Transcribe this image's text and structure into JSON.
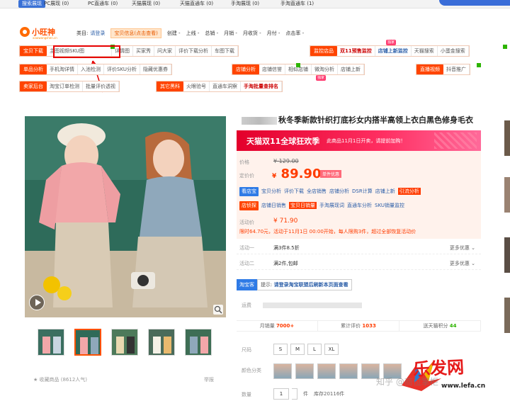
{
  "top_strip": {
    "tag": "搜索展现",
    "items": [
      "PC展现 (0)",
      "PC直通车 (0)",
      "天猫展现 (0)",
      "天猫直通车 (0)",
      "手淘展现 (0)",
      "手淘直通车 (1)"
    ]
  },
  "plugin": {
    "logo_text": "小旺神",
    "logo_sub": "xiaowangshen.cn",
    "row1": {
      "category_label": "类目:",
      "category_value": "请登录",
      "info_button": "宝贝信息(点击查看)",
      "fields": [
        "创建 -",
        "上线 -",
        "总销 -",
        "月销 -",
        "月收货 -",
        "月付 -",
        "点击率 -"
      ]
    },
    "bar1": {
      "primary": "宝贝下载",
      "items": [
        "主图视频SKU图",
        "详情图",
        "买家秀",
        "问大家",
        "评价下载分析",
        "车图下载"
      ]
    },
    "bar1b": {
      "primary": "监控店品",
      "items": [
        "双11预售监控",
        "店铺上新监控",
        "天猫搜索",
        "小蛋金搜索"
      ],
      "hot": "独家"
    },
    "bar2": {
      "primary": "单品分析",
      "items": [
        "手机淘详情",
        "入池检测",
        "评价SKU分析",
        "隐藏优惠券"
      ]
    },
    "bar2b": {
      "primary": "店铺分析",
      "items": [
        "店铺信誉",
        "相似店铺",
        "微淘分析",
        "店铺上新"
      ]
    },
    "bar2c": {
      "primary": "直播视频",
      "items": [
        "抖音推广"
      ]
    },
    "bar3": {
      "primary": "卖家后台",
      "items": [
        "淘宝订单检测",
        "批量评价透视"
      ]
    },
    "bar3b": {
      "primary": "其它黑科",
      "items": [
        "火眼验号",
        "直通车洞察",
        "手淘批量查排名"
      ],
      "hot": "独家"
    }
  },
  "product": {
    "title": "秋冬季新款针织打底衫女内搭半高领上衣白黑色修身毛衣",
    "promo_big": "天猫双11全球狂欢季",
    "promo_small": "此商品11月1日开卖，请提前加购！",
    "price_label": "价格",
    "orig_price": "¥ 129.00",
    "deal_label": "定价价",
    "deal_currency": "¥",
    "deal_price": "89.90",
    "deal_badge": "单件优惠",
    "tools1": {
      "tag": "看店宝",
      "links": [
        "宝贝分析",
        "评价下载",
        "全店销售",
        "店铺分析",
        "DSR计算",
        "店铺上新"
      ],
      "highlight": "引流分析"
    },
    "tools2": {
      "tag": "店侦探",
      "links": [
        "店铺日销售"
      ],
      "highlight": "宝贝日销量",
      "links2": [
        "手淘展现词",
        "直通车分析",
        "SKU销量监控"
      ]
    },
    "act_label": "活动价",
    "act_price": "¥ 71.90",
    "act_note": "限时64.70元，活动于11月1日 00:00开始，每人限购3件，超过全部恢复活动价",
    "events": [
      {
        "label": "活动一",
        "text": "满3件8.5折",
        "more": "更多优惠"
      },
      {
        "label": "活动二",
        "text": "满2件,包邮",
        "more": "更多优惠"
      }
    ],
    "taobao_tag": "淘宝客",
    "taobao_msg_prefix": "提示:",
    "taobao_msg": "请登录淘宝联盟后刷新本页面查看",
    "ship_label": "运费",
    "stats": [
      {
        "label": "月销量",
        "value": "7000+"
      },
      {
        "label": "累计评价",
        "value": "1033"
      },
      {
        "label": "送天猫积分",
        "value": "44"
      }
    ],
    "size_label": "尺码",
    "sizes": [
      "S",
      "M",
      "L",
      "XL"
    ],
    "color_label": "颜色分类",
    "qty_label": "数量",
    "qty_value": "1",
    "qty_unit": "件",
    "stock": "库存20116件",
    "fav": "收藏商品 (8612人气)",
    "report": "举报"
  },
  "watermark": {
    "site": "乐发网",
    "url": "www.lefa.cn",
    "faint": "知乎 @商位掌柜"
  }
}
